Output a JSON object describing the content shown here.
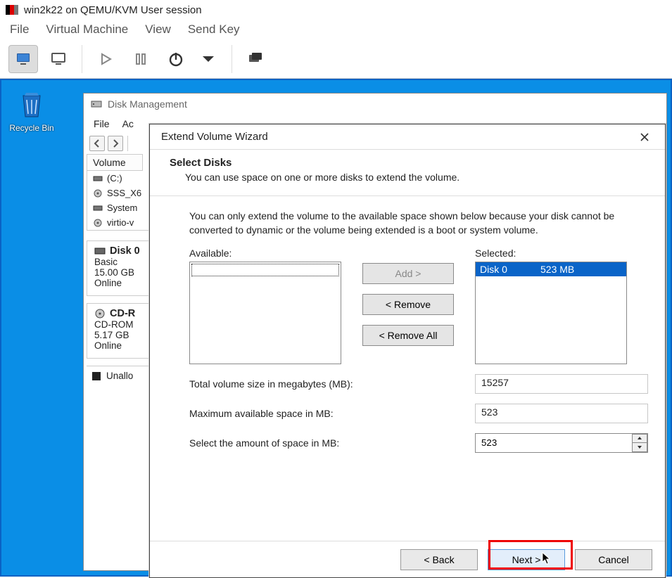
{
  "vm": {
    "title": "win2k22 on QEMU/KVM User session",
    "menu": {
      "file": "File",
      "vm": "Virtual Machine",
      "view": "View",
      "send_key": "Send Key"
    }
  },
  "desktop": {
    "recycle_label": "Recycle Bin"
  },
  "dm": {
    "title": "Disk Management",
    "menu": {
      "file": "File",
      "action_trunc": "Ac"
    },
    "col_header": "Volume",
    "rows": {
      "c": "(C:)",
      "sss": "SSS_X6",
      "system": "System",
      "virtio": "virtio-v"
    },
    "disk0": {
      "title_trunc": "Disk 0",
      "type": "Basic",
      "size": "15.00 GB",
      "status": "Online"
    },
    "cdrom": {
      "title_trunc": "CD-R",
      "type": "CD-ROM",
      "size": "5.17 GB",
      "status": "Online"
    },
    "legend": "Unallo"
  },
  "wiz": {
    "title": "Extend Volume Wizard",
    "header": {
      "h1": "Select Disks",
      "sub": "You can use space on one or more disks to extend the volume."
    },
    "info": "You can only extend the volume to the available space shown below because your disk cannot be converted to dynamic or the volume being extended is a boot or system volume.",
    "labels": {
      "available": "Available:",
      "selected": "Selected:",
      "add": "Add >",
      "remove": "< Remove",
      "remove_all": "< Remove All",
      "total": "Total volume size in megabytes (MB):",
      "max": "Maximum available space in MB:",
      "amount": "Select the amount of space in MB:"
    },
    "selected_item": {
      "disk": "Disk 0",
      "size": "523 MB"
    },
    "values": {
      "total": "15257",
      "max": "523",
      "amount": "523"
    },
    "footer": {
      "back": "< Back",
      "next": "Next >",
      "cancel": "Cancel"
    }
  }
}
